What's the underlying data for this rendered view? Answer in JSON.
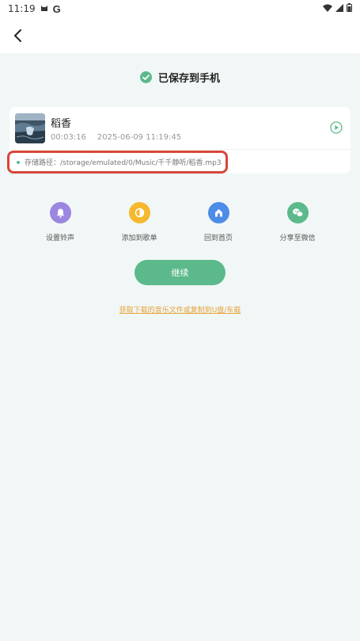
{
  "status_bar": {
    "time": "11:19",
    "app_letter": "G"
  },
  "header": {
    "saved_label": "已保存到手机"
  },
  "song": {
    "title": "稻香",
    "duration": "00:03:16",
    "saved_at": "2025-06-09 11:19:45"
  },
  "storage": {
    "path": "存储路径：/storage/emulated/0/Music/千千静听/稻香.mp3"
  },
  "actions": [
    {
      "label": "设置铃声",
      "icon": "bell-icon",
      "color": "#9b86e0"
    },
    {
      "label": "添加到歌单",
      "icon": "playlist-icon",
      "color": "#f5b82e"
    },
    {
      "label": "回到首页",
      "icon": "home-icon",
      "color": "#4e8ce8"
    },
    {
      "label": "分享至微信",
      "icon": "wechat-icon",
      "color": "#5cb98b"
    }
  ],
  "continue_label": "继续",
  "help_link": "获取下载的音乐文件或复制到U盘/车载",
  "colors": {
    "accent": "#5cb98b",
    "link": "#e8a33a",
    "highlight": "#d7463a",
    "background": "#f1f7f6"
  }
}
